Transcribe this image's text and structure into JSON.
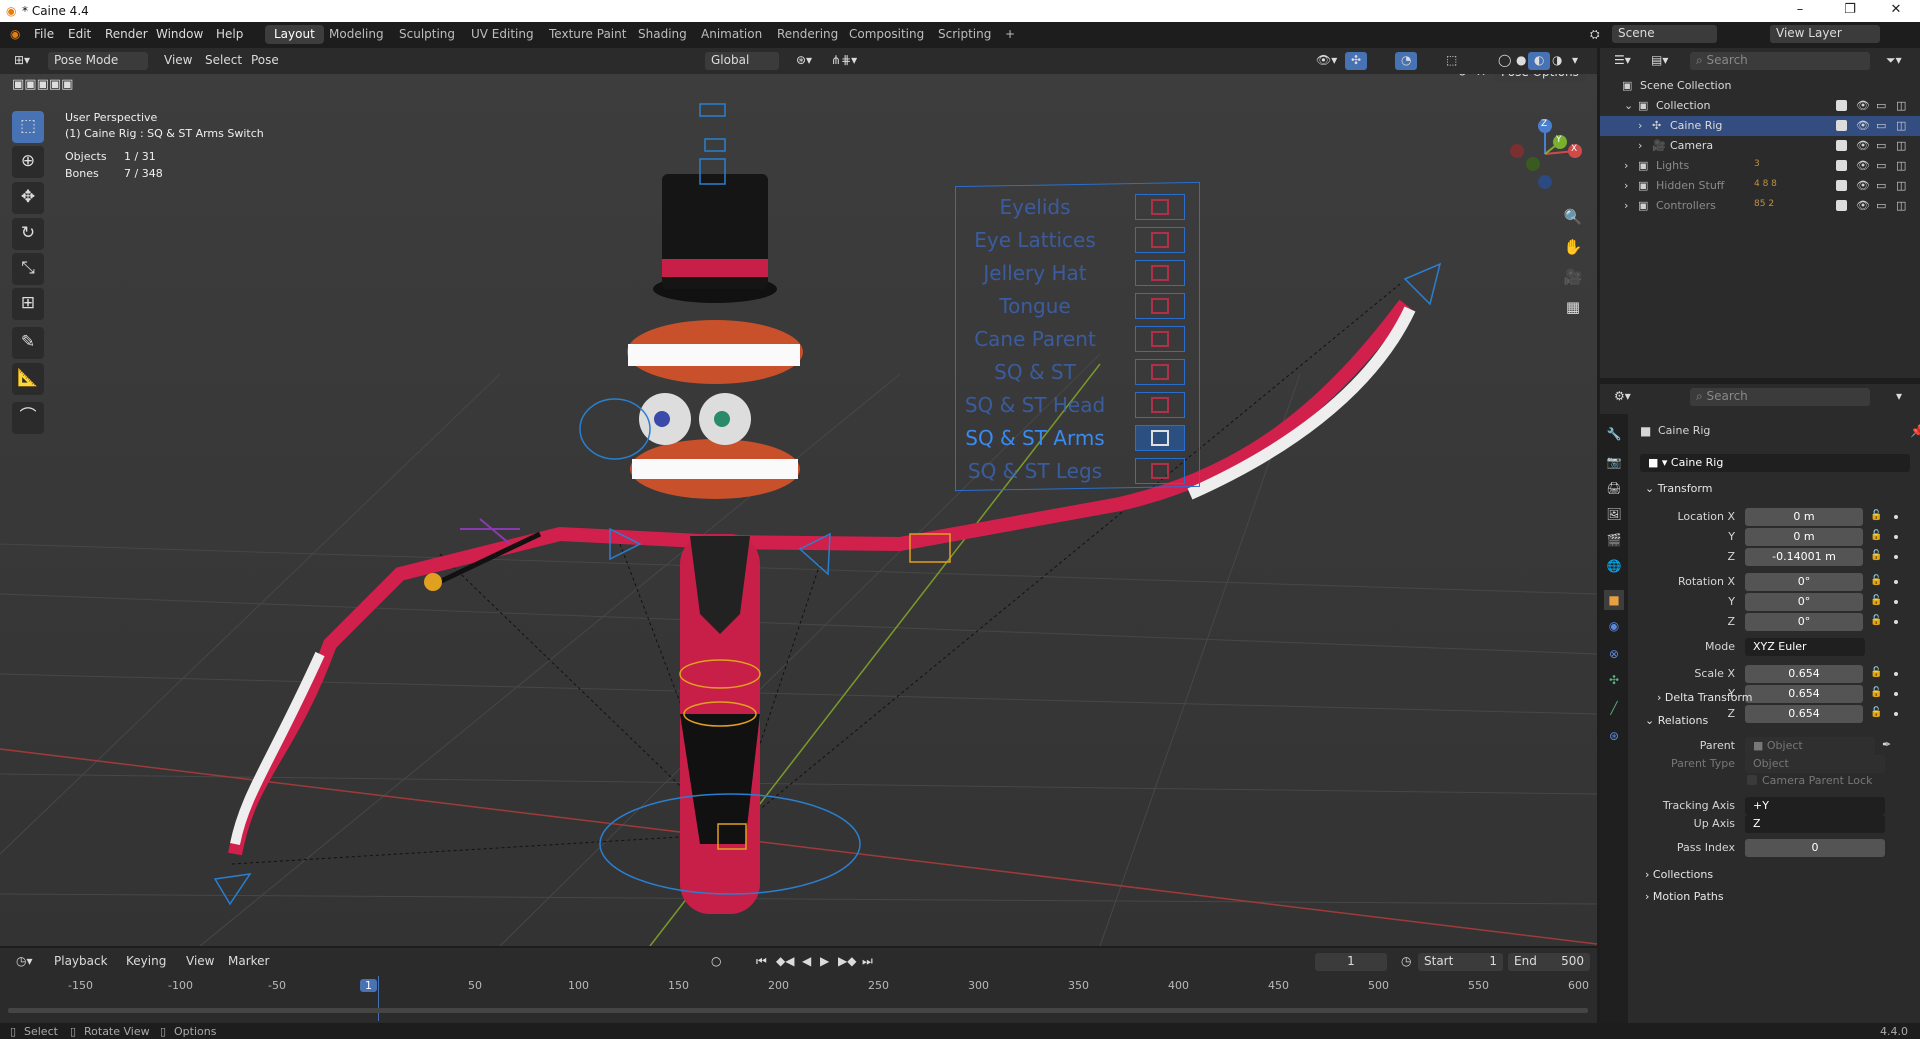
{
  "window": {
    "title": "* Caine 4.4",
    "minimize": "–",
    "maximize": "❐",
    "close": "✕"
  },
  "menu": [
    "File",
    "Edit",
    "Render",
    "Window",
    "Help"
  ],
  "workspaces": [
    "Layout",
    "Modeling",
    "Sculpting",
    "UV Editing",
    "Texture Paint",
    "Shading",
    "Animation",
    "Rendering",
    "Compositing",
    "Scripting",
    "+"
  ],
  "active_workspace": "Layout",
  "scene": {
    "label": "Scene",
    "view_layer": "View Layer"
  },
  "header3d": {
    "mode": "Pose Mode",
    "menus": [
      "View",
      "Select",
      "Pose"
    ],
    "orientation": "Global",
    "pose_options": "Pose Options"
  },
  "overlay": {
    "perspective": "User Perspective",
    "active": "(1) Caine Rig : SQ & ST Arms Switch",
    "objects_label": "Objects",
    "objects_value": "1 / 31",
    "bones_label": "Bones",
    "bones_value": "7 / 348"
  },
  "switch_panel": {
    "items": [
      "Eyelids",
      "Eye Lattices",
      "Jellery Hat",
      "Tongue",
      "Cane Parent",
      "SQ & ST",
      "SQ & ST Head",
      "SQ & ST Arms",
      "SQ & ST Legs"
    ],
    "active": "SQ & ST Arms"
  },
  "gizmo": {
    "z": "Z",
    "x": "X",
    "y": "Y"
  },
  "outliner": {
    "search": "Search",
    "root": "Scene Collection",
    "rows": [
      {
        "name": "Collection",
        "indent": 1,
        "state": "normal"
      },
      {
        "name": "Caine Rig",
        "indent": 2,
        "state": "selected"
      },
      {
        "name": "Camera",
        "indent": 2,
        "state": "normal"
      },
      {
        "name": "Lights",
        "indent": 1,
        "state": "dim",
        "badge": "3"
      },
      {
        "name": "Hidden Stuff",
        "indent": 1,
        "state": "dim",
        "badge": "4  8  8"
      },
      {
        "name": "Controllers",
        "indent": 1,
        "state": "dim",
        "badge": "85  2"
      }
    ]
  },
  "properties": {
    "search": "Search",
    "object_name": "Caine Rig",
    "object_field": "Caine Rig",
    "transform": {
      "header": "Transform",
      "location_label": "Location X",
      "location": [
        "0 m",
        "0 m",
        "-0.14001 m"
      ],
      "rotation_label": "Rotation X",
      "rotation": [
        "0°",
        "0°",
        "0°"
      ],
      "mode_label": "Mode",
      "mode": "XYZ Euler",
      "scale_label": "Scale X",
      "scale": [
        "0.654",
        "0.654",
        "0.654"
      ],
      "y_label": "Y",
      "z_label": "Z"
    },
    "delta_transform": "Delta Transform",
    "relations": {
      "header": "Relations",
      "parent_label": "Parent",
      "parent_placeholder": "Object",
      "parent_type_label": "Parent Type",
      "parent_type": "Object",
      "camera_parent_lock": "Camera Parent Lock",
      "tracking_axis_label": "Tracking Axis",
      "tracking_axis": "+Y",
      "up_axis_label": "Up Axis",
      "up_axis": "Z",
      "pass_index_label": "Pass Index",
      "pass_index": "0"
    },
    "collections": "Collections",
    "motion_paths": "Motion Paths"
  },
  "timeline": {
    "menus": [
      "Playback",
      "Keying",
      "View",
      "Marker"
    ],
    "current_frame": "1",
    "start_label": "Start",
    "start": "1",
    "end_label": "End",
    "end": "500",
    "ticks": [
      "-150",
      "-100",
      "-50",
      "1",
      "50",
      "100",
      "150",
      "200",
      "250",
      "300",
      "350",
      "400",
      "450",
      "500",
      "550",
      "600"
    ],
    "playhead": "1"
  },
  "status": {
    "select": "Select",
    "rotate": "Rotate View",
    "options": "Options",
    "version": "4.4.0"
  },
  "colors": {
    "accent": "#4772b3",
    "selected_row": "#334d80",
    "panel": "#2b2b2b",
    "viewport": "#3c3c3c"
  }
}
